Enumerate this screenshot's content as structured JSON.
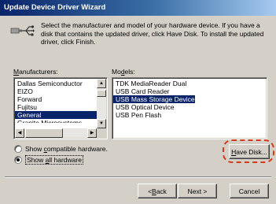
{
  "window": {
    "title": "Update Device Driver Wizard"
  },
  "header": {
    "icon": "usb-plug-icon",
    "text": "Select the manufacturer and model of your hardware device. If you have a disk that contains the updated driver, click Have Disk. To install the updated driver, click Finish."
  },
  "manufacturers": {
    "label_accel": "M",
    "label_rest": "anufacturers:",
    "items": [
      "Dallas Semiconductor",
      "EIZO",
      "Forward",
      "Fujitsu",
      "General",
      "Granite Microsystems"
    ],
    "selected": "General"
  },
  "models": {
    "label_pre": "Mo",
    "label_accel": "d",
    "label_rest": "els:",
    "items": [
      "TDK MediaReader Dual",
      "USB Card Reader",
      "USB Mass Storage Device",
      "USB Optical Device",
      "USB Pen Flash"
    ],
    "selected": "USB Mass Storage Device"
  },
  "options": {
    "compatible": {
      "pre": "Show ",
      "accel": "c",
      "rest": "ompatible hardware.",
      "selected": false
    },
    "all": {
      "pre": "Show ",
      "accel": "a",
      "rest": "ll hardware",
      "selected": true
    }
  },
  "buttons": {
    "have_disk": {
      "accel": "H",
      "rest": "ave Disk..."
    },
    "back": {
      "pre": "< ",
      "accel": "B",
      "rest": "ack"
    },
    "next": "Next >",
    "cancel": "Cancel"
  },
  "colors": {
    "title_start": "#0a246a",
    "title_end": "#a6caf0",
    "selection": "#0a246a",
    "highlight_ring": "#d43a1a"
  }
}
